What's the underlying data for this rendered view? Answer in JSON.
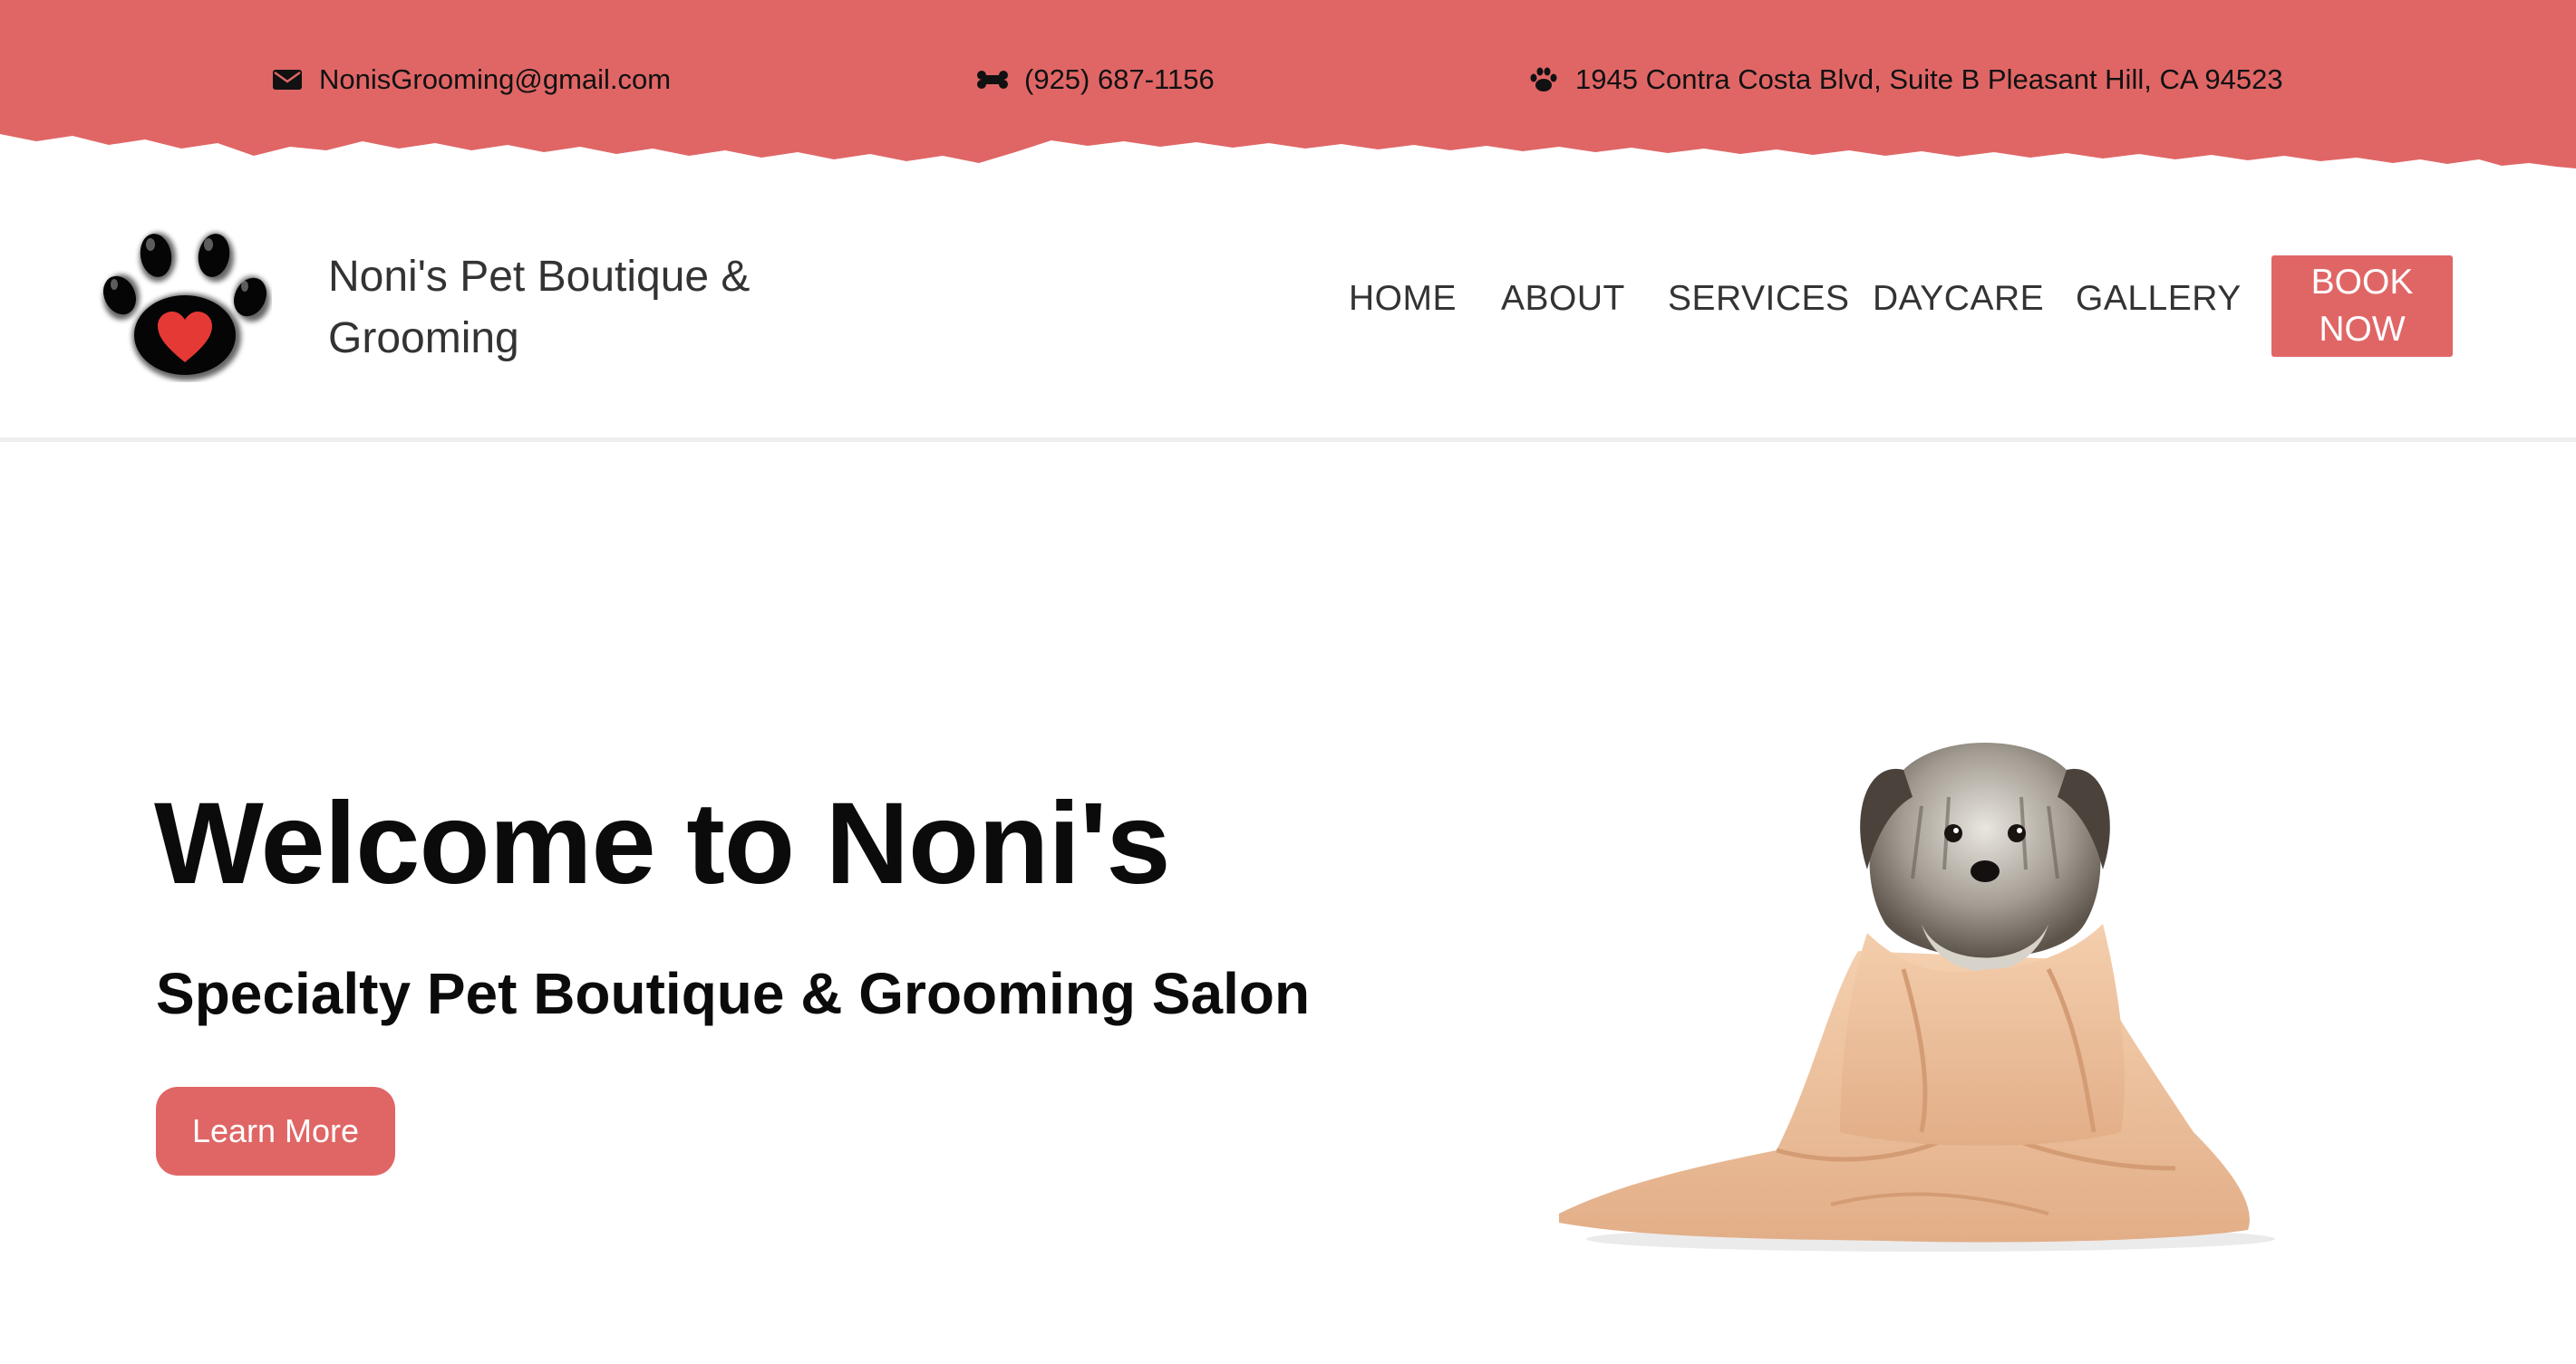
{
  "topbar": {
    "background": "#e06666",
    "email": {
      "icon": "envelope-icon",
      "text": "NonisGrooming@gmail.com"
    },
    "phone": {
      "icon": "bone-icon",
      "text": "(925) 687-1156"
    },
    "address": {
      "icon": "paw-icon",
      "text": "1945 Contra Costa Blvd, Suite B Pleasant Hill, CA 94523"
    }
  },
  "header": {
    "logo_icon": "paw-heart-logo",
    "brand_name": "Noni's Pet Boutique & Grooming",
    "nav": [
      "HOME",
      "ABOUT",
      "SERVICES",
      "DAYCARE",
      "GALLERY"
    ],
    "book_button": {
      "line1": "BOOK",
      "line2": "NOW"
    }
  },
  "hero": {
    "title": "Welcome to Noni's",
    "subtitle": "Specialty Pet Boutique & Grooming Salon",
    "cta": "Learn More",
    "image_icon": "puppy-in-towel-image"
  },
  "colors": {
    "accent": "#e06666",
    "text": "#111111"
  }
}
